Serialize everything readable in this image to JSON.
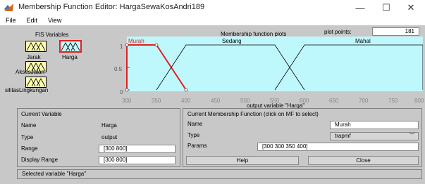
{
  "window": {
    "title": "Membership Function Editor: HargaSewaKosAndri189",
    "min_glyph": "—",
    "max_glyph": "☐",
    "close_glyph": "✕",
    "icon": "matlab-icon"
  },
  "menu": {
    "file": "File",
    "edit": "Edit",
    "view": "View"
  },
  "fis": {
    "title": "FIS Variables",
    "inputs": [
      "Jarak",
      "AksesJalan",
      "silitasLingkungan"
    ],
    "output": "Harga"
  },
  "plot": {
    "title": "Membership function plots",
    "points_label": "plot points:",
    "points_value": "181",
    "background": "#bff8fc",
    "selected_color": "#e02020",
    "mf_names": [
      "Murah",
      "Sedang",
      "Mahal"
    ],
    "yticks": [
      "1",
      "0.5",
      "0"
    ],
    "xticks": [
      "300",
      "350",
      "400",
      "450",
      "500",
      "550",
      "600",
      "650",
      "700",
      "750",
      "800"
    ],
    "xlabel": "output variable \"Harga\""
  },
  "chart_data": {
    "type": "line",
    "xlim": [
      300,
      800
    ],
    "ylim": [
      0,
      1
    ],
    "series": [
      {
        "name": "Murah",
        "x": [
          300,
          300,
          350,
          400
        ],
        "y": [
          0,
          1,
          1,
          0
        ]
      },
      {
        "name": "Sedang",
        "x": [
          350,
          400,
          550,
          600
        ],
        "y": [
          0,
          1,
          1,
          0
        ]
      },
      {
        "name": "Mahal",
        "x": [
          550,
          600,
          800,
          800
        ],
        "y": [
          0,
          1,
          1,
          0
        ]
      }
    ]
  },
  "current_variable": {
    "title": "Current Variable",
    "name_label": "Name",
    "name_value": "Harga",
    "type_label": "Type",
    "type_value": "output",
    "range_label": "Range",
    "range_value": "[300 800]",
    "display_range_label": "Display Range",
    "display_range_value": "[300 800]"
  },
  "current_mf": {
    "title": "Current Membership Function (click on MF to select)",
    "name_label": "Name",
    "name_value": "Murah",
    "type_label": "Type",
    "type_value": "trapmf",
    "params_label": "Params",
    "params_value": "[300 300 350 400]"
  },
  "buttons": {
    "help": "Help",
    "close": "Close"
  },
  "status": "Selected variable \"Harga\""
}
